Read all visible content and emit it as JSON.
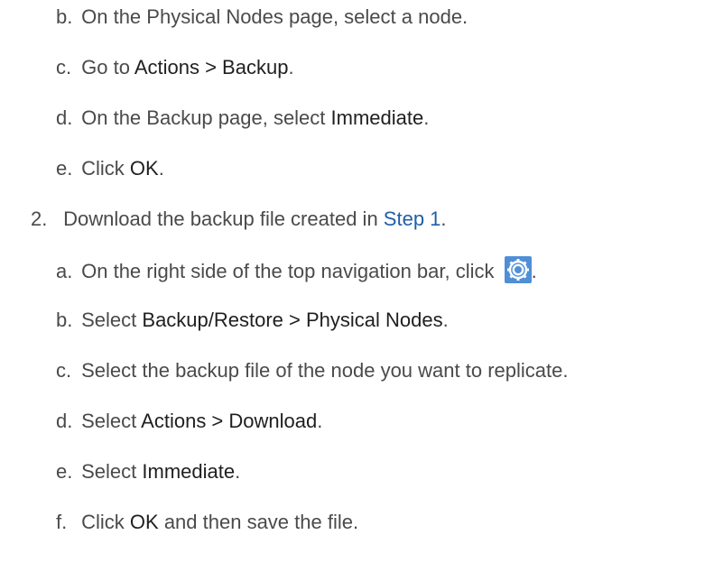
{
  "steps": {
    "b1": {
      "marker": "b.",
      "text": "On the Physical Nodes page, select a node."
    },
    "c1": {
      "marker": "c.",
      "pre": "Go to ",
      "bold": "Actions > Backup",
      "post": "."
    },
    "d1": {
      "marker": "d.",
      "pre": "On the Backup page, select ",
      "bold": "Immediate",
      "post": "."
    },
    "e1": {
      "marker": "e.",
      "pre": "Click ",
      "bold": "OK",
      "post": "."
    },
    "step2": {
      "marker": "2.",
      "pre": "Download the backup file created in ",
      "link": "Step 1",
      "post": "."
    },
    "a2": {
      "marker": "a.",
      "pre": "On the right side of the top navigation bar, click ",
      "post": "."
    },
    "b2": {
      "marker": "b.",
      "pre": "Select ",
      "bold": "Backup/Restore > Physical Nodes",
      "post": "."
    },
    "c2": {
      "marker": "c.",
      "text": "Select the backup file of the node you want to replicate."
    },
    "d2": {
      "marker": "d.",
      "pre": "Select ",
      "bold": "Actions > Download",
      "post": "."
    },
    "e2": {
      "marker": "e.",
      "pre": "Select ",
      "bold": "Immediate",
      "post": "."
    },
    "f2": {
      "marker": "f.",
      "pre": "Click ",
      "bold": "OK",
      "post": " and then save the file."
    }
  },
  "icons": {
    "settings": "gear-icon"
  },
  "colors": {
    "text": "#4a4a4a",
    "bold": "#1f1f1f",
    "link": "#1f5fa8",
    "gear_bg": "#4f8fd6"
  }
}
